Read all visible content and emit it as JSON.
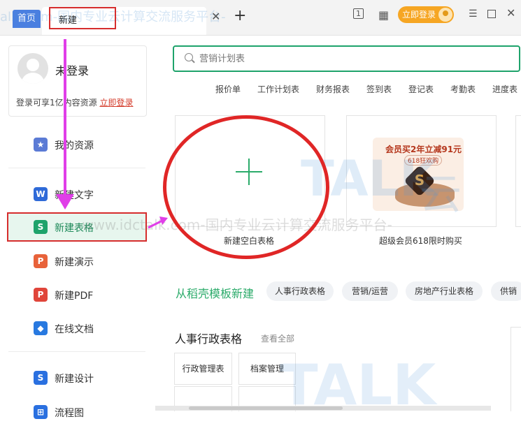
{
  "titlebar": {
    "tabs": [
      {
        "label": "首页"
      },
      {
        "label": "新建"
      }
    ],
    "login_label": "立即登录",
    "watermark": "allk.com-国内专业云计算交流服务平台-"
  },
  "user": {
    "name": "未登录",
    "tip": "登录可享1亿内容资源",
    "login_link": "立即登录"
  },
  "sidebar": {
    "items": [
      {
        "label": "我的资源",
        "icon": "star-icon",
        "color": "#5b7bd5"
      },
      {
        "label": "新建文字",
        "icon": "word-icon",
        "color": "#2f6ad8"
      },
      {
        "label": "新建表格",
        "icon": "sheet-icon",
        "color": "#1ea36b"
      },
      {
        "label": "新建演示",
        "icon": "presentation-icon",
        "color": "#e8623a"
      },
      {
        "label": "新建PDF",
        "icon": "pdf-icon",
        "color": "#e0453a"
      },
      {
        "label": "在线文档",
        "icon": "online-doc-icon",
        "color": "#2879e0"
      },
      {
        "label": "新建设计",
        "icon": "design-icon",
        "color": "#2a70e0"
      },
      {
        "label": "流程图",
        "icon": "flowchart-icon",
        "color": "#2a70e0"
      }
    ]
  },
  "search": {
    "placeholder": "营销计划表"
  },
  "quick_links": [
    "报价单",
    "工作计划表",
    "财务报表",
    "签到表",
    "登记表",
    "考勤表",
    "进度表"
  ],
  "cards": {
    "blank": {
      "label": "新建空白表格"
    },
    "vip": {
      "label": "超级会员618限时购买",
      "banner_line1": "会员买2年立减91元",
      "banner_line2": "618狂欢购"
    }
  },
  "templates": {
    "heading": "从稻壳模板新建",
    "chips": [
      "人事行政表格",
      "营销/运营",
      "房地产行业表格",
      "供销"
    ],
    "category_title": "人事行政表格",
    "view_all": "查看全部",
    "items": [
      "行政管理表",
      "档案管理"
    ]
  },
  "watermark": {
    "middle": "-www.idctalk.com-国内专业云计算交流服务平台-",
    "brand": "TALK",
    "brand_cn": "云"
  },
  "colors": {
    "accent": "#1ea36b",
    "highlight": "#d62d2d",
    "arrow": "#e03ee8",
    "login": "#f6a623"
  }
}
